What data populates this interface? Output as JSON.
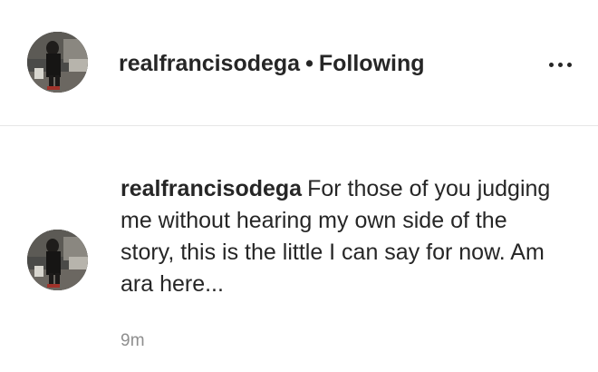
{
  "header": {
    "username": "realfrancisodega",
    "separator": "•",
    "follow_status": "Following"
  },
  "post": {
    "caption_username": "realfrancisodega",
    "caption_text": "For those of you judging me without hearing my own side of the story, this is the little I can say for now. Am ara here...",
    "timestamp": "9m"
  },
  "icons": {
    "more": "more-options-icon",
    "avatar": "profile-avatar"
  }
}
